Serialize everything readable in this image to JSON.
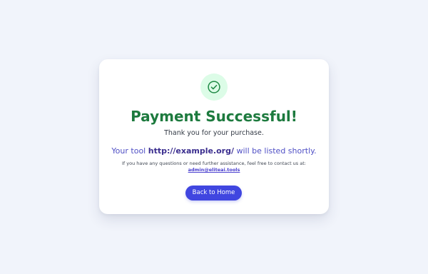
{
  "card": {
    "title": "Payment Successful!",
    "thanks": "Thank you for your purchase.",
    "tool_prefix": "Your tool ",
    "tool_url": "http://example.org/",
    "tool_suffix": " will be listed shortly.",
    "contact_text": "If you have any questions or need further assistance, feel free to contact us at:",
    "contact_email": "admin@eliteai.tools",
    "button_label": "Back to Home",
    "icon": "check-circle-icon"
  },
  "colors": {
    "page_background": "#f1f4fb",
    "success_green": "#1d7a3e",
    "icon_bg": "#dcfce7",
    "accent": "#4046e0"
  }
}
